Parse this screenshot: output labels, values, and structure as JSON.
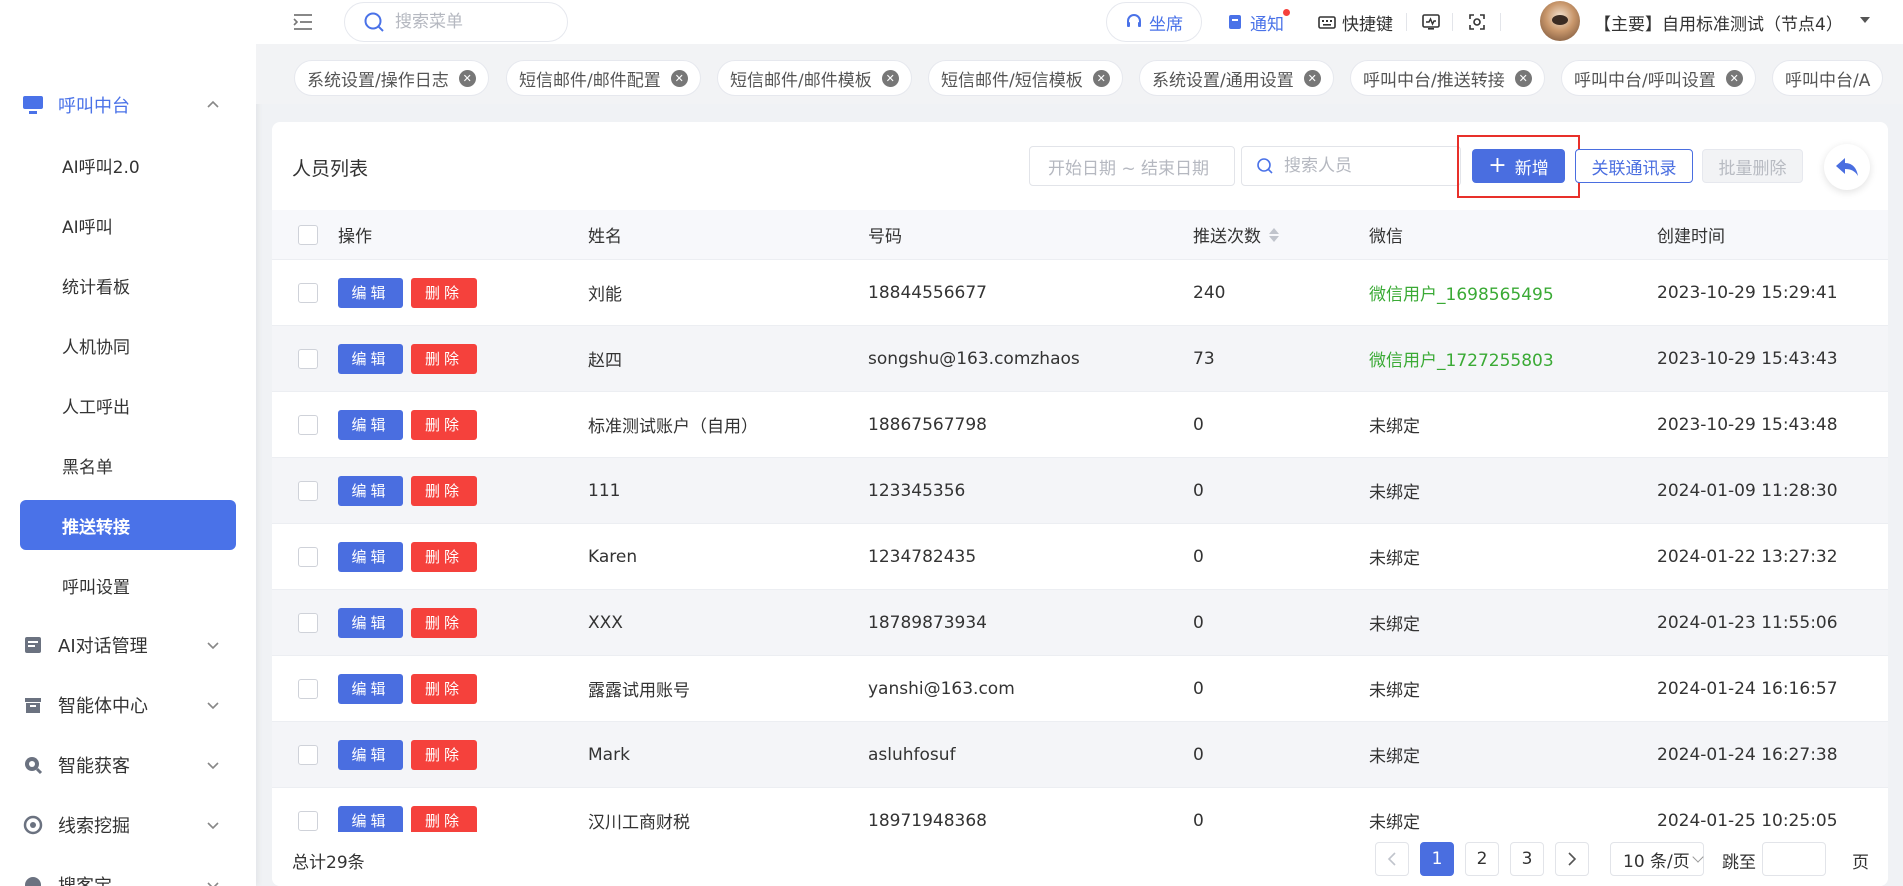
{
  "header": {
    "search_placeholder": "搜索菜单",
    "seat_label": "坐席",
    "notify_label": "通知",
    "shortcut_label": "快捷键",
    "account_label": "【主要】自用标准测试（节点4）"
  },
  "sidebar": {
    "groups": [
      {
        "label": "呼叫中台"
      },
      {
        "label": "AI对话管理"
      },
      {
        "label": "智能体中心"
      },
      {
        "label": "智能获客"
      },
      {
        "label": "线索挖掘"
      },
      {
        "label": "搜客宝"
      }
    ],
    "sub_items": [
      {
        "label": "AI呼叫2.0"
      },
      {
        "label": "AI呼叫"
      },
      {
        "label": "统计看板"
      },
      {
        "label": "人机协同"
      },
      {
        "label": "人工呼出"
      },
      {
        "label": "黑名单"
      },
      {
        "label": "推送转接"
      },
      {
        "label": "呼叫设置"
      }
    ]
  },
  "tags": [
    {
      "label": "系统设置/操作日志"
    },
    {
      "label": "短信邮件/邮件配置"
    },
    {
      "label": "短信邮件/邮件模板"
    },
    {
      "label": "短信邮件/短信模板"
    },
    {
      "label": "系统设置/通用设置"
    },
    {
      "label": "呼叫中台/推送转接"
    },
    {
      "label": "呼叫中台/呼叫设置"
    },
    {
      "label": "呼叫中台/A"
    }
  ],
  "card": {
    "title": "人员列表",
    "date_placeholder": "开始日期 ~ 结束日期",
    "search_placeholder": "搜索人员",
    "add_label": "新增",
    "link_contacts_label": "关联通讯录",
    "batch_delete_label": "批量删除"
  },
  "table": {
    "columns": {
      "op": "操作",
      "name": "姓名",
      "number": "号码",
      "count": "推送次数",
      "wechat": "微信",
      "created": "创建时间"
    },
    "edit_label": "编辑",
    "delete_label": "删除",
    "rows": [
      {
        "name": "刘能",
        "number": "18844556677",
        "count": "240",
        "wechat": "微信用户_1698565495",
        "created": "2023-10-29 15:29:41"
      },
      {
        "name": "赵四",
        "number": "songshu@163.comzhaos",
        "count": "73",
        "wechat": "微信用户_1727255803",
        "created": "2023-10-29 15:43:43"
      },
      {
        "name": "标准测试账户（自用）",
        "number": "18867567798",
        "count": "0",
        "wechat": "未绑定",
        "created": "2023-10-29 15:43:48"
      },
      {
        "name": "111",
        "number": "123345356",
        "count": "0",
        "wechat": "未绑定",
        "created": "2024-01-09 11:28:30"
      },
      {
        "name": "Karen",
        "number": "1234782435",
        "count": "0",
        "wechat": "未绑定",
        "created": "2024-01-22 13:27:32"
      },
      {
        "name": "XXX",
        "number": "18789873934",
        "count": "0",
        "wechat": "未绑定",
        "created": "2024-01-23 11:55:06"
      },
      {
        "name": "露露试用账号",
        "number": "yanshi@163.com",
        "count": "0",
        "wechat": "未绑定",
        "created": "2024-01-24 16:16:57"
      },
      {
        "name": "Mark",
        "number": "asluhfosuf",
        "count": "0",
        "wechat": "未绑定",
        "created": "2024-01-24 16:27:38"
      },
      {
        "name": "汉川工商财税",
        "number": "18971948368",
        "count": "0",
        "wechat": "未绑定",
        "created": "2024-01-25 10:25:05"
      }
    ]
  },
  "footer": {
    "total_label": "总计29条",
    "pages": [
      "1",
      "2",
      "3"
    ],
    "page_size_label": "10 条/页",
    "jump_label": "跳至",
    "page_suffix": "页"
  },
  "colors": {
    "primary": "#4a6ee0",
    "danger": "#f5413c",
    "success": "#3aaa35",
    "highlight": "#e8302a"
  }
}
